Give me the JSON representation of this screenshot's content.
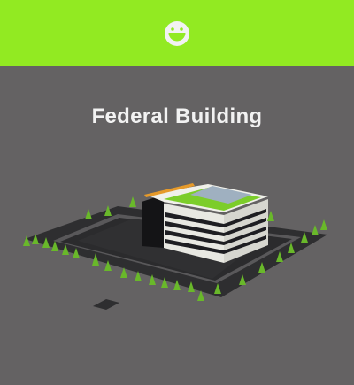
{
  "header": {
    "icon": "smiley-icon",
    "color": "#92ea22"
  },
  "card": {
    "title": "Federal Building",
    "background": "#646263"
  },
  "illustration": {
    "subject": "isometric-office-building"
  }
}
